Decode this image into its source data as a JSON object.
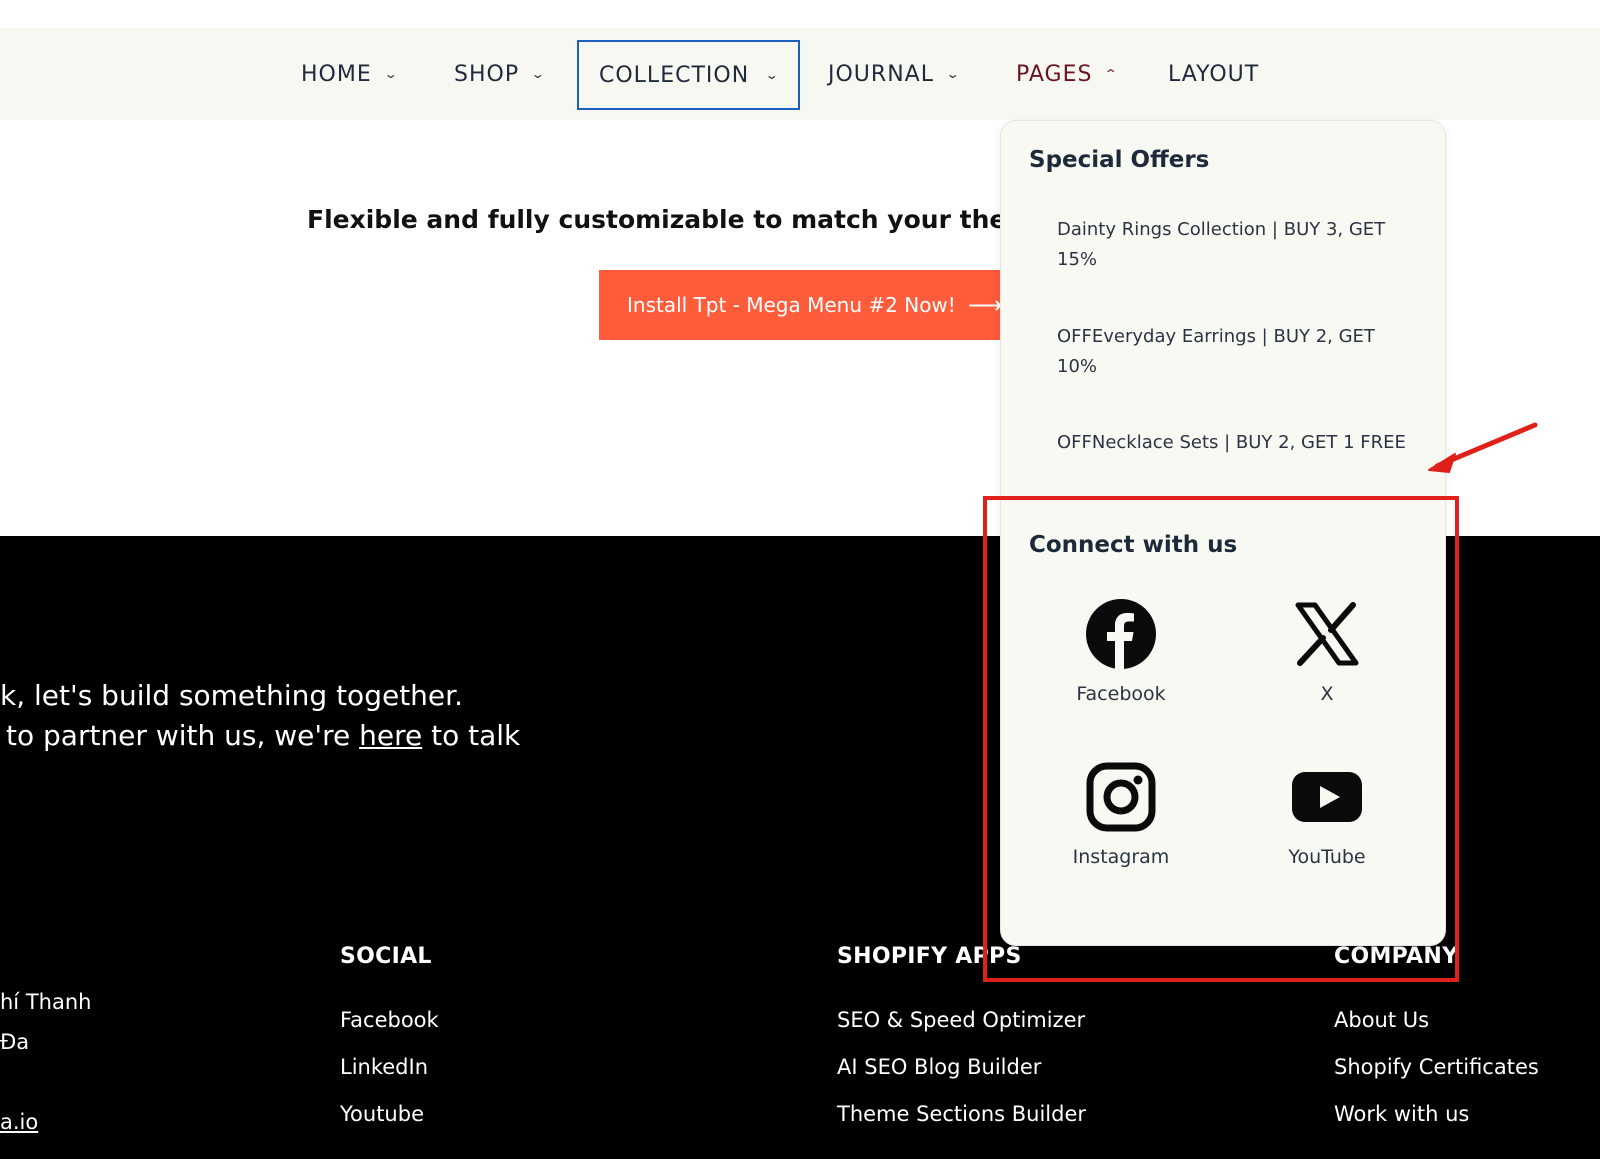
{
  "nav": {
    "items": [
      {
        "label": "HOME",
        "chevron": "⌄"
      },
      {
        "label": "SHOP",
        "chevron": "⌄"
      },
      {
        "label": "COLLECTION",
        "chevron": "⌄"
      },
      {
        "label": "JOURNAL",
        "chevron": "⌄"
      },
      {
        "label": "PAGES",
        "chevron": "⌃"
      },
      {
        "label": "LAYOUT",
        "chevron": ""
      }
    ],
    "active": "PAGES",
    "focused": "COLLECTION"
  },
  "hero": {
    "text": "Flexible and fully customizable to match your them",
    "cta_label": "Install Tpt - Mega Menu #2 Now!",
    "cta_arrow": "⟶"
  },
  "dropdown": {
    "offers_heading": "Special Offers",
    "offers": [
      "Dainty Rings Collection | BUY 3, GET 15%",
      "OFFEveryday Earrings | BUY 2, GET 10%",
      "OFFNecklace Sets | BUY 2, GET 1 FREE"
    ],
    "connect_heading": "Connect with us",
    "socials": [
      {
        "label": "Facebook",
        "icon": "facebook-icon"
      },
      {
        "label": "X",
        "icon": "x-icon"
      },
      {
        "label": "Instagram",
        "icon": "instagram-icon"
      },
      {
        "label": "YouTube",
        "icon": "youtube-icon"
      }
    ]
  },
  "footer": {
    "tagline_line1": "k, let's build something together.",
    "tagline_line2_pre": "to partner with us, we're ",
    "tagline_link": "here",
    "tagline_line2_post": " to talk",
    "left_fragments": [
      "hí Thanh",
      "Đa",
      "a.io"
    ],
    "columns": [
      {
        "title": "SOCIAL",
        "links": [
          "Facebook",
          "LinkedIn",
          "Youtube"
        ]
      },
      {
        "title": "SHOPIFY APPS",
        "links": [
          "SEO & Speed Optimizer",
          "AI SEO Blog Builder",
          "Theme Sections Builder"
        ]
      },
      {
        "title": "COMPANY",
        "links": [
          "About Us",
          "Shopify Certificates",
          "Work with us"
        ]
      }
    ]
  },
  "colors": {
    "cta": "#ff5c3c",
    "active_nav": "#6b1323",
    "focus_outline": "#1d5fbf",
    "annotation_red": "#e0211b",
    "footer_bg": "#000000"
  }
}
